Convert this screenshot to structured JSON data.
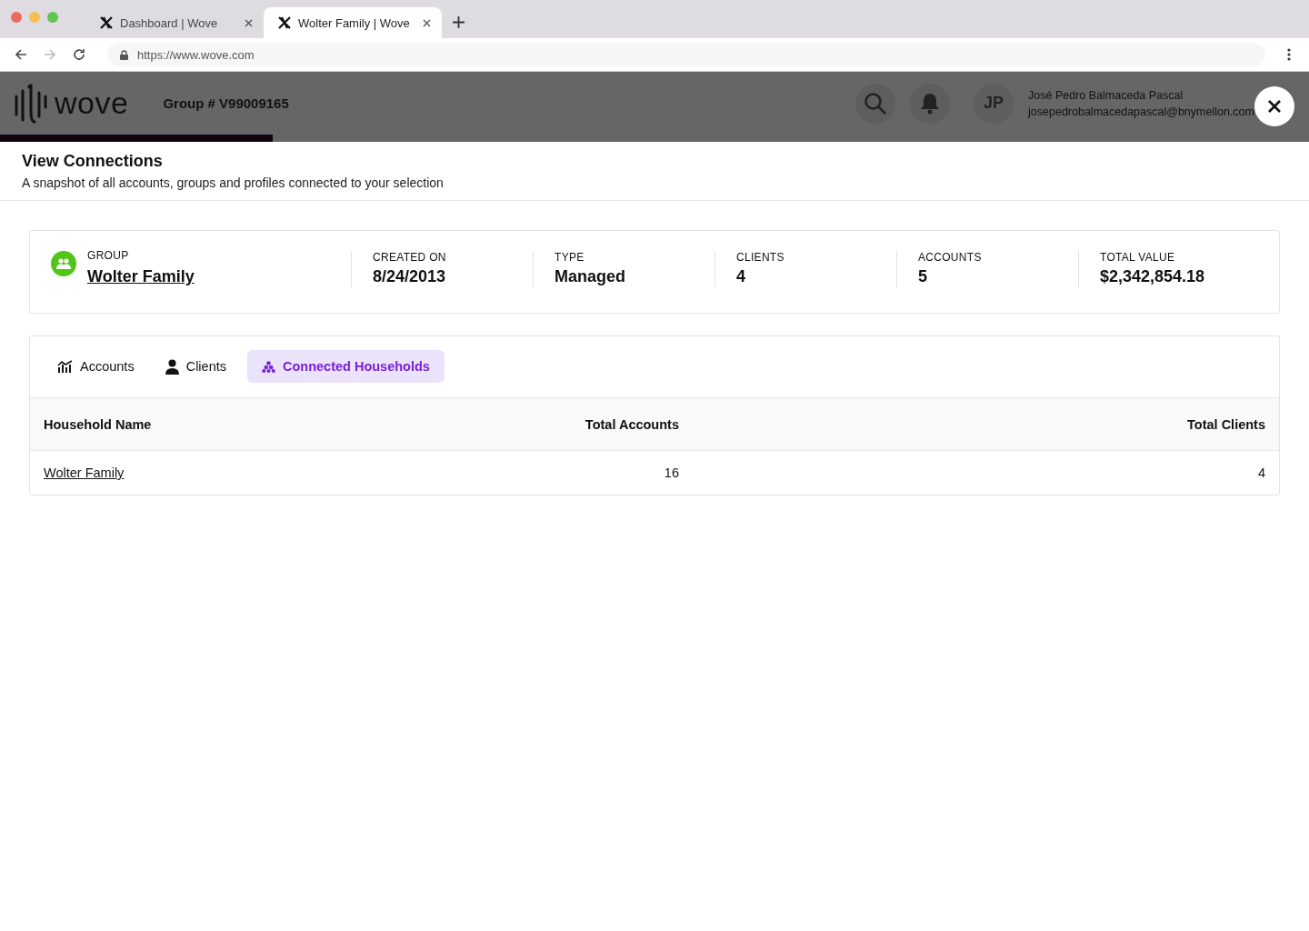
{
  "browser": {
    "tabs": [
      {
        "title": "Dashboard | Wove",
        "selected": false
      },
      {
        "title": "Wolter Family | Wove",
        "selected": true
      }
    ],
    "url": "https://www.wove.com"
  },
  "header": {
    "logo": "wove",
    "group": "Group # V99009165",
    "user": {
      "initials": "JP",
      "name": "José Pedro Balmaceda Pascal",
      "email": "josepedrobalmacedapascal@bnymellon.com"
    }
  },
  "modal": {
    "title": "View Connections",
    "subtitle": "A snapshot of all accounts, groups and profiles connected to your selection",
    "summary": {
      "label": "GROUP",
      "name": "Wolter Family",
      "stats": [
        {
          "label": "CREATED ON",
          "value": "8/24/2013"
        },
        {
          "label": "TYPE",
          "value": "Managed"
        },
        {
          "label": "CLIENTS",
          "value": "4"
        },
        {
          "label": "ACCOUNTS",
          "value": "5"
        },
        {
          "label": "TOTAL VALUE",
          "value": "$2,342,854.18"
        }
      ]
    },
    "tabs": [
      {
        "label": "Accounts",
        "kind": "chart",
        "selected": false
      },
      {
        "label": "Clients",
        "kind": "person",
        "selected": false
      },
      {
        "label": "Connected Households",
        "kind": "cluster",
        "selected": true
      }
    ],
    "table": {
      "columns": [
        "Household Name",
        "Total Accounts",
        "Total Clients"
      ],
      "rows": [
        [
          "Wolter Family",
          "16",
          "4"
        ]
      ]
    }
  }
}
